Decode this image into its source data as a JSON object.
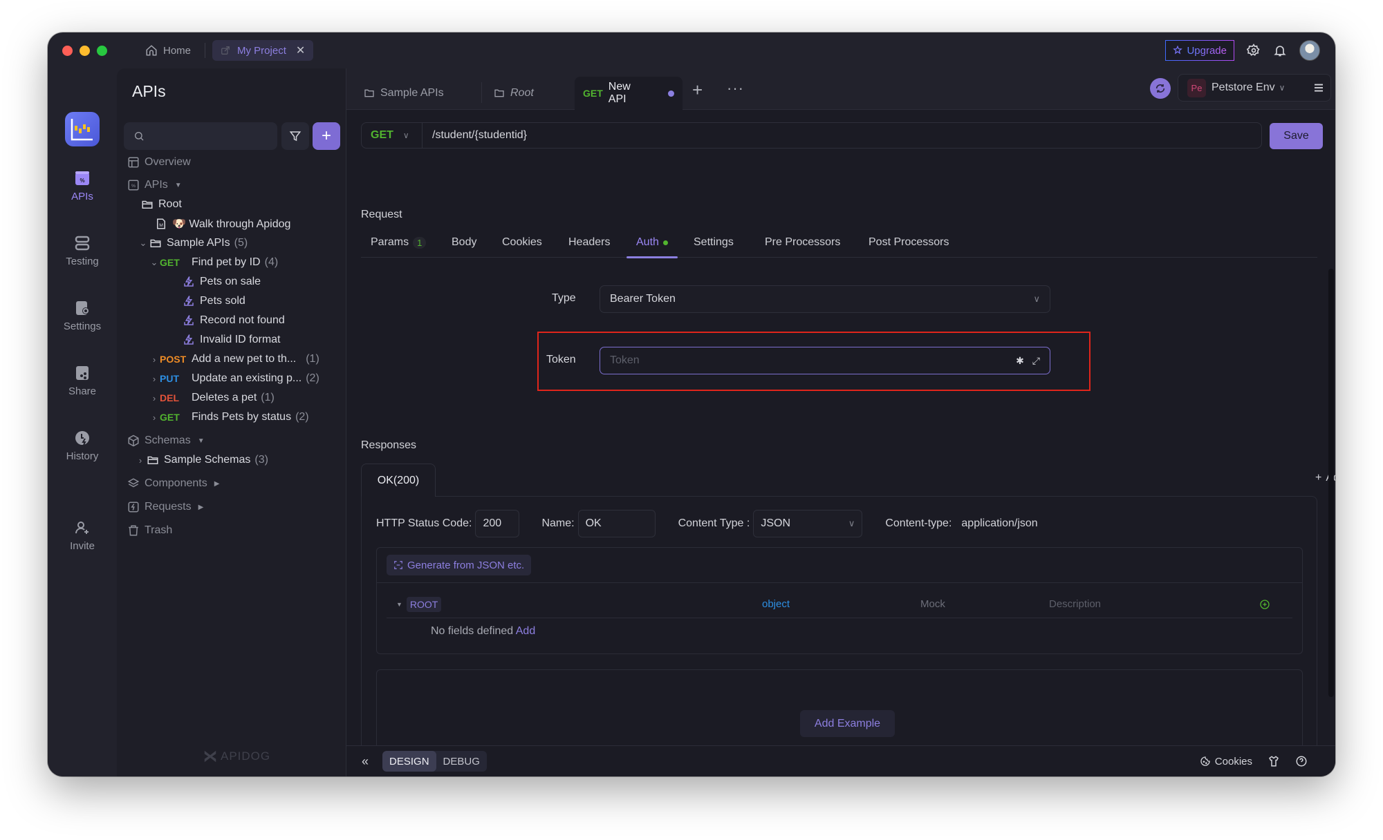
{
  "titlebar": {
    "home_label": "Home",
    "project_tab_label": "My Project",
    "upgrade_label": "Upgrade"
  },
  "rail": {
    "items": [
      {
        "label": "APIs",
        "icon": "api-icon",
        "active": true
      },
      {
        "label": "Testing",
        "icon": "testing-icon"
      },
      {
        "label": "Settings",
        "icon": "settings-icon"
      },
      {
        "label": "Share",
        "icon": "share-icon"
      },
      {
        "label": "History",
        "icon": "history-icon"
      },
      {
        "label": "Invite",
        "icon": "invite-icon"
      }
    ]
  },
  "sidebar": {
    "title": "APIs",
    "search_placeholder": "",
    "brand": "APIDOG",
    "tree": {
      "overview": "Overview",
      "apis": "APIs",
      "root": "Root",
      "walkthrough": "🐶 Walk through Apidog",
      "sample_apis": {
        "label": "Sample APIs",
        "count": "(5)"
      },
      "endpoints": [
        {
          "method": "GET",
          "label": "Find pet by ID",
          "count": "(4)",
          "expanded": true,
          "cases": [
            "Pets on sale",
            "Pets sold",
            "Record not found",
            "Invalid ID format"
          ]
        },
        {
          "method": "POST",
          "label": "Add a new pet to th...",
          "count": "(1)"
        },
        {
          "method": "PUT",
          "label": "Update an existing p...",
          "count": "(2)"
        },
        {
          "method": "DEL",
          "label": "Deletes a pet",
          "count": "(1)"
        },
        {
          "method": "GET",
          "label": "Finds Pets by status",
          "count": "(2)"
        }
      ],
      "schemas": "Schemas",
      "sample_schemas": {
        "label": "Sample Schemas",
        "count": "(3)"
      },
      "components": "Components",
      "requests": "Requests",
      "trash": "Trash"
    }
  },
  "tabs": [
    {
      "label": "Sample APIs",
      "icon": "folder-icon"
    },
    {
      "label": "Root",
      "icon": "folder-icon"
    },
    {
      "method": "GET",
      "label": "New API",
      "active": true,
      "unsaved": true
    }
  ],
  "environment": {
    "badge": "Pe",
    "name": "Petstore Env"
  },
  "request": {
    "method": "GET",
    "path": "/student/{studentid}",
    "save_label": "Save",
    "section_label": "Request",
    "subtabs": [
      {
        "label": "Params",
        "badge": "1"
      },
      {
        "label": "Body"
      },
      {
        "label": "Cookies"
      },
      {
        "label": "Headers"
      },
      {
        "label": "Auth",
        "active": true,
        "dot": true
      },
      {
        "label": "Settings"
      },
      {
        "label": "Pre Processors"
      },
      {
        "label": "Post Processors"
      }
    ],
    "auth": {
      "type_label": "Type",
      "type_value": "Bearer Token",
      "token_label": "Token",
      "token_value": "",
      "token_placeholder": "Token"
    }
  },
  "responses": {
    "section_label": "Responses",
    "add_label": "Add",
    "active_tab": "OK(200)",
    "status_code_label": "HTTP Status Code:",
    "status_code": "200",
    "name_label": "Name:",
    "name_value": "OK",
    "content_type_label": "Content Type :",
    "content_type_value": "JSON",
    "content_type_header_label": "Content-type:",
    "content_type_header_value": "application/json",
    "generate_label": "Generate from JSON etc.",
    "schema": {
      "root_label": "ROOT",
      "root_type": "object",
      "mock_placeholder": "Mock",
      "description_placeholder": "Description",
      "empty_text": "No fields defined",
      "empty_add": "Add"
    },
    "add_example_label": "Add Example"
  },
  "footer": {
    "modes": [
      "DESIGN",
      "DEBUG"
    ],
    "active_mode": "DESIGN",
    "cookies_label": "Cookies"
  },
  "colors": {
    "accent": "#8874d8",
    "get": "#52b52f",
    "post": "#ef8c26",
    "put": "#2d8fe3",
    "delete": "#e4533a",
    "highlight_border": "#e0251b"
  }
}
